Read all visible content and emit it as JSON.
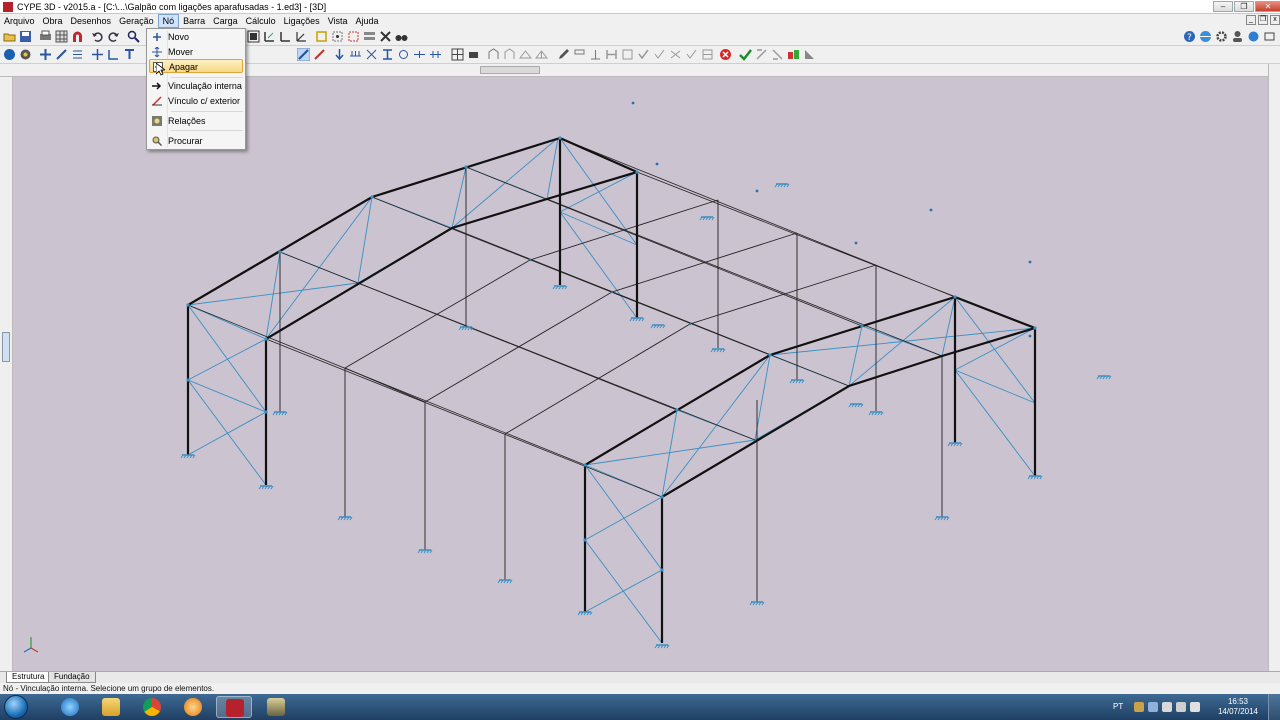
{
  "window": {
    "title": "CYPE 3D - v2015.a - [C:\\...\\Galpão com ligações aparafusadas - 1.ed3] - [3D]",
    "controls": [
      "minimize",
      "restore",
      "close"
    ]
  },
  "menubar": {
    "items": [
      "Arquivo",
      "Obra",
      "Desenhos",
      "Geração",
      "Nó",
      "Barra",
      "Carga",
      "Cálculo",
      "Ligações",
      "Vista",
      "Ajuda"
    ],
    "active": "Nó"
  },
  "node_menu": {
    "items": [
      {
        "label": "Novo",
        "icon": "plus-icon"
      },
      {
        "label": "Mover",
        "icon": "move-icon"
      },
      {
        "label": "Apagar",
        "icon": "delete-icon",
        "highlighted": true
      },
      {
        "label": "Vinculação interna",
        "icon": "arrow-right-icon"
      },
      {
        "label": "Vínculo c/ exterior",
        "icon": "support-icon"
      },
      {
        "label": "Relações",
        "icon": "relations-icon"
      },
      {
        "label": "Procurar",
        "icon": "search-icon"
      }
    ]
  },
  "tabs": [
    "Estrutura",
    "Fundação"
  ],
  "status": "Nó - Vinculação interna.  Selecione um grupo de elementos.",
  "taskbar": {
    "language": "PT",
    "time": "16:53",
    "date": "14/07/2014",
    "apps": [
      "internet-explorer",
      "file-explorer",
      "chrome",
      "media-player",
      "cype",
      "cype-tools"
    ]
  },
  "colors": {
    "viewport_bg": "#cbc3cf",
    "frame_members": "#111111",
    "bracing": "#3a8fc4",
    "menu_highlight": "#f7d985"
  }
}
